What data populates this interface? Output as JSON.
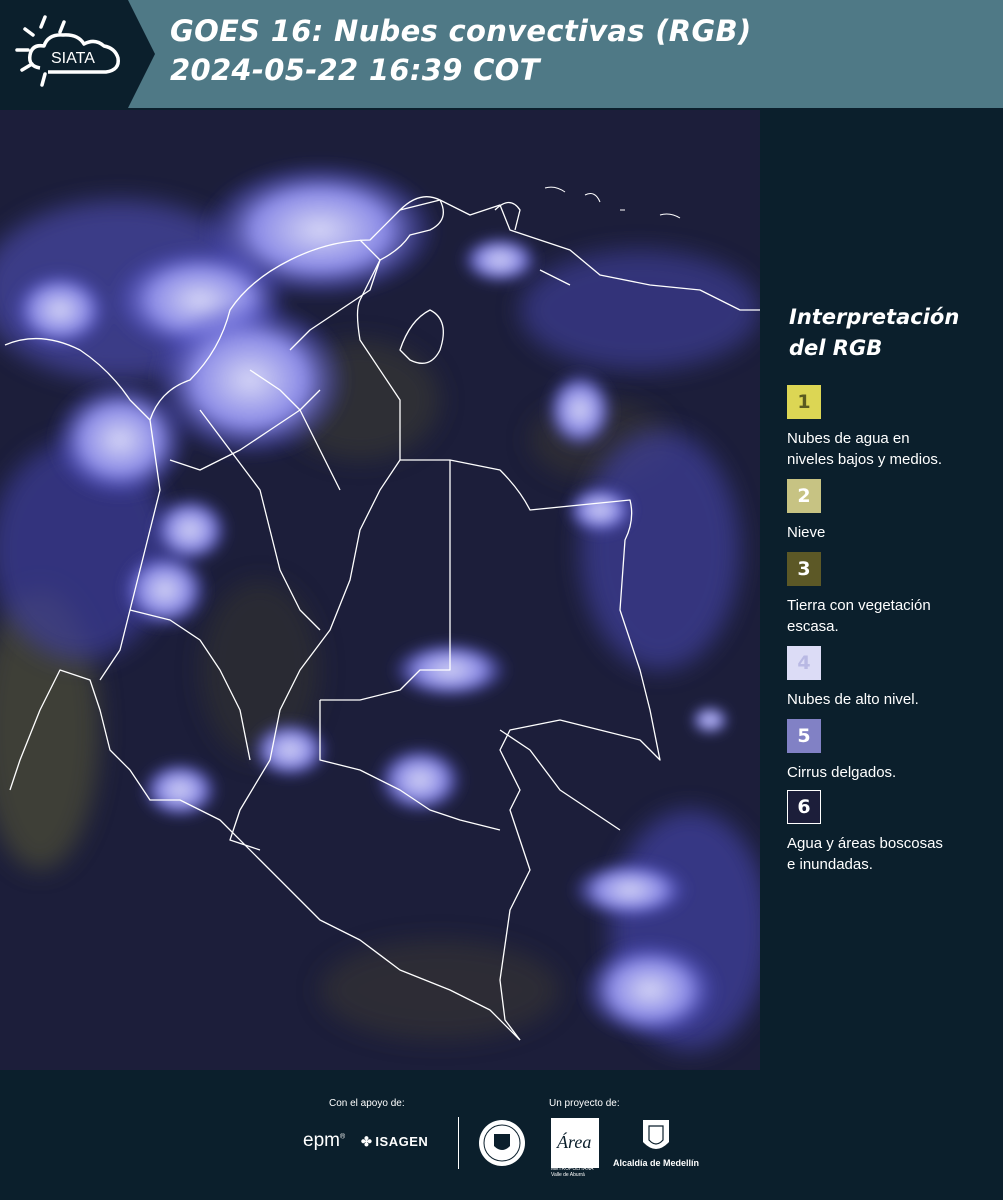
{
  "header": {
    "logo_text": "SIATA",
    "title_line1": "GOES 16: Nubes convectivas (RGB)",
    "title_line2": " 2024-05-22 16:39 COT"
  },
  "legend": {
    "title_line1": "Interpretación",
    "title_line2": "del RGB",
    "items": [
      {
        "number": "1",
        "color": "#dcd654",
        "text_color": "#5a5a20",
        "line1": "Nubes de agua en",
        "line2": "niveles bajos y medios."
      },
      {
        "number": "2",
        "color": "#c7c383",
        "text_color": "#ffffff",
        "line1": "Nieve",
        "line2": ""
      },
      {
        "number": "3",
        "color": "#5c5826",
        "text_color": "#ffffff",
        "line1": "Tierra con vegetación",
        "line2": "escasa."
      },
      {
        "number": "4",
        "color": "#dcdcf6",
        "text_color": "#b9b9e4",
        "line1": "Nubes de alto nivel.",
        "line2": ""
      },
      {
        "number": "5",
        "color": "#8181c5",
        "text_color": "#ffffff",
        "line1": "Cirrus delgados.",
        "line2": ""
      },
      {
        "number": "6",
        "color": "#1c1e3a",
        "text_color": "#ffffff",
        "line1": "Agua y áreas boscosas",
        "line2": "e inundadas."
      }
    ]
  },
  "footer": {
    "support_label": "Con el apoyo de:",
    "project_label": "Un proyecto de:",
    "sponsor_epm": "epm",
    "sponsor_isagen": "ISAGEN",
    "sponsor_area_line1": "METROPOLITANA",
    "sponsor_area_line2": "Valle de Aburrá",
    "sponsor_alcaldia": "Alcaldía de Medellín"
  },
  "colors": {
    "header_bg": "#4f7986",
    "logo_bg": "#0b1f2c",
    "page_bg": "#0b1f2c",
    "ocean": "#1a1d38",
    "cloud_high": "#c9c9f2",
    "cloud_thin": "#6a6ad8",
    "border_lines": "#ffffff"
  }
}
